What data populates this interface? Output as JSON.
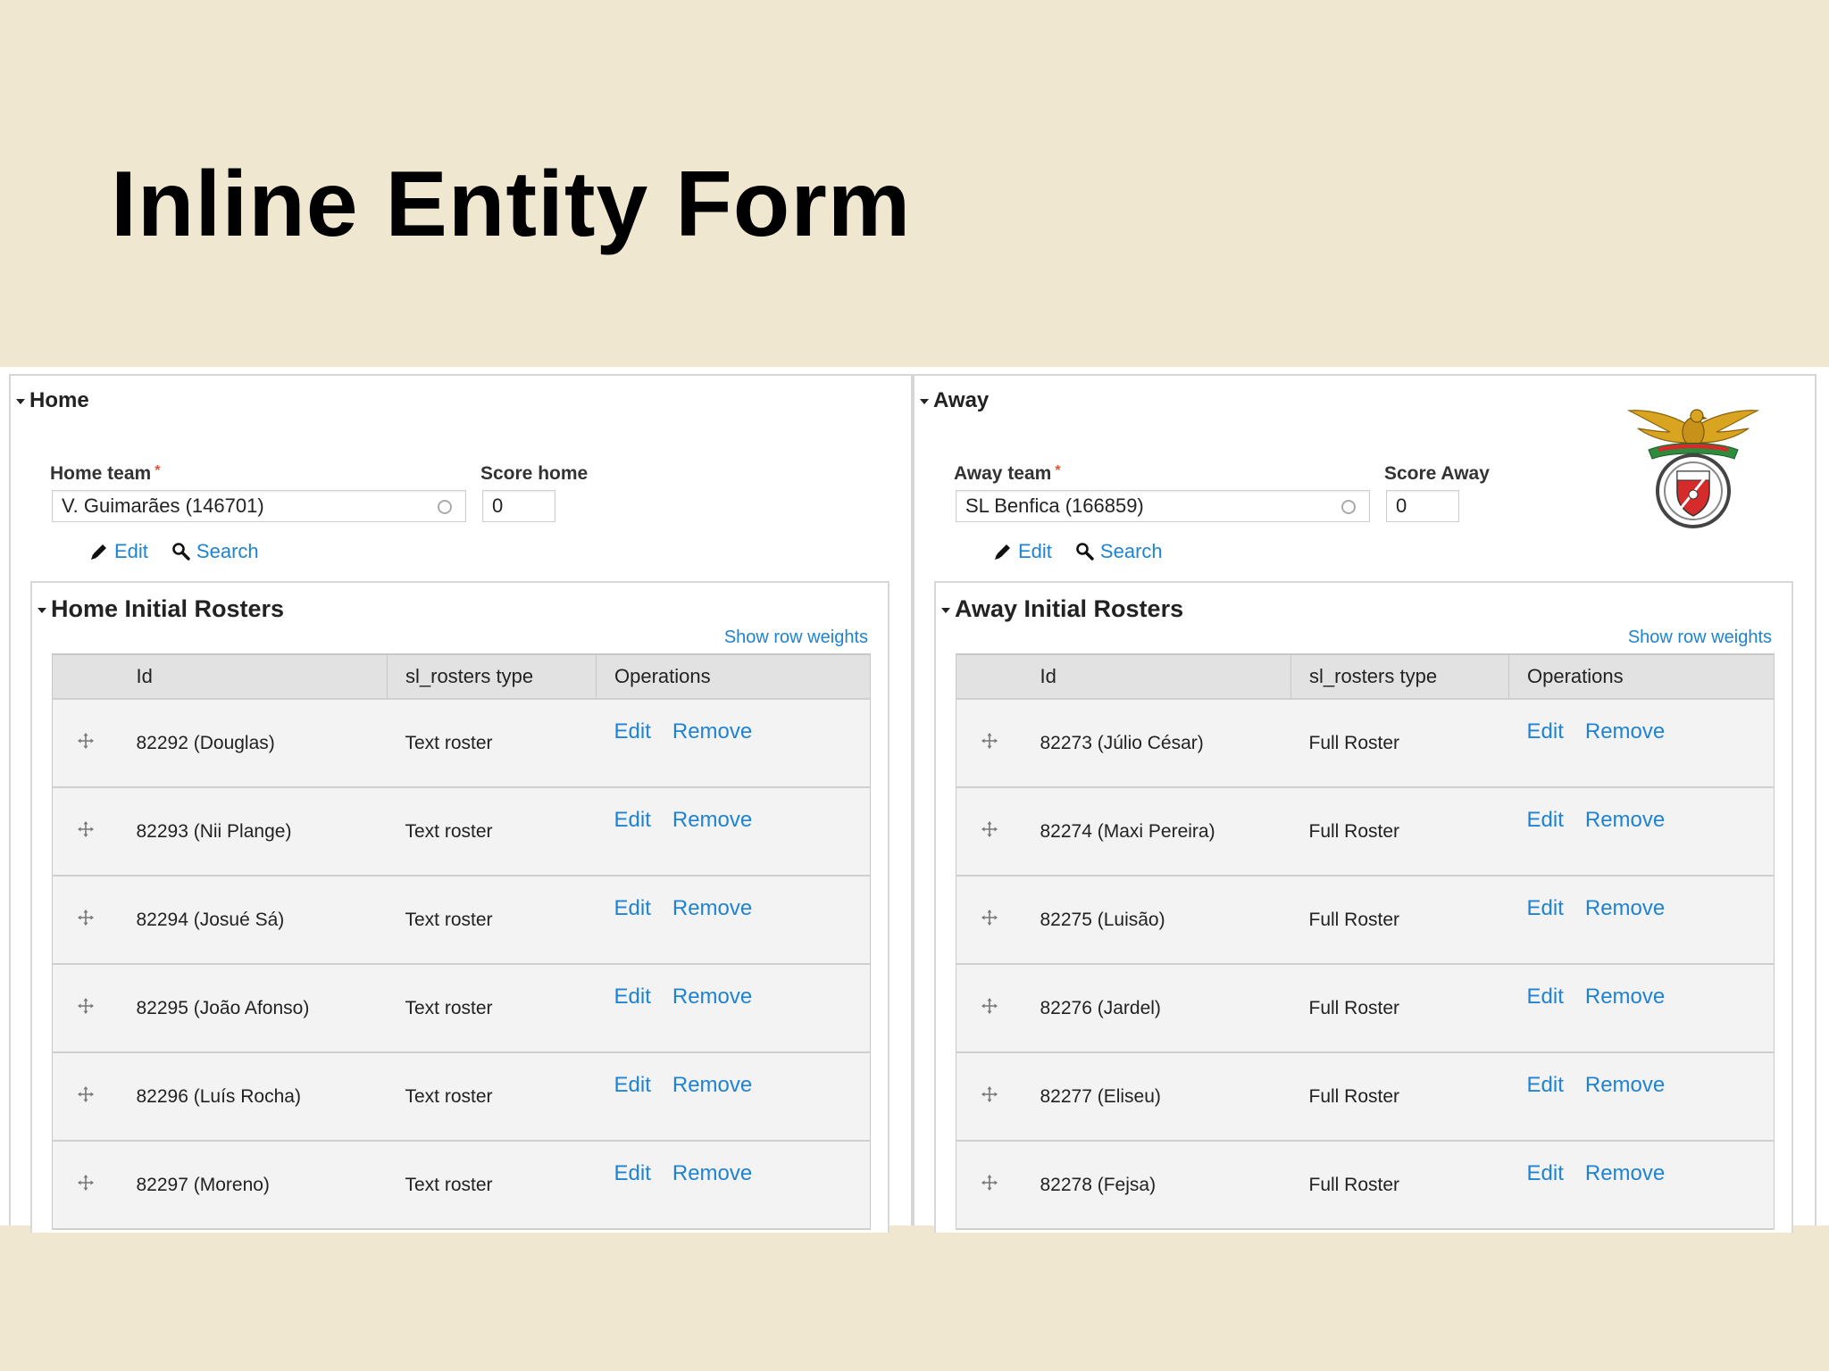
{
  "slide": {
    "title": "Inline Entity Form"
  },
  "home": {
    "legend": "Home",
    "team_label": "Home team",
    "required_mark": "*",
    "team_value": "V. Guimarães (146701)",
    "score_label": "Score home",
    "score_value": "0",
    "edit_link": "Edit",
    "search_link": "Search",
    "rosters": {
      "legend": "Home Initial Rosters",
      "show_weights": "Show row weights",
      "columns": [
        "Id",
        "sl_rosters type",
        "Operations"
      ],
      "rows": [
        {
          "id": "82292 (Douglas)",
          "type": "Text roster"
        },
        {
          "id": "82293 (Nii Plange)",
          "type": "Text roster"
        },
        {
          "id": "82294 (Josué Sá)",
          "type": "Text roster"
        },
        {
          "id": "82295 (João Afonso)",
          "type": "Text roster"
        },
        {
          "id": "82296 (Luís Rocha)",
          "type": "Text roster"
        },
        {
          "id": "82297 (Moreno)",
          "type": "Text roster"
        }
      ],
      "edit_label": "Edit",
      "remove_label": "Remove"
    }
  },
  "away": {
    "legend": "Away",
    "team_label": "Away team",
    "required_mark": "*",
    "team_value": "SL Benfica (166859)",
    "score_label": "Score Away",
    "score_value": "0",
    "edit_link": "Edit",
    "search_link": "Search",
    "rosters": {
      "legend": "Away Initial Rosters",
      "show_weights": "Show row weights",
      "columns": [
        "Id",
        "sl_rosters type",
        "Operations"
      ],
      "rows": [
        {
          "id": "82273 (Júlio César)",
          "type": "Full Roster"
        },
        {
          "id": "82274 (Maxi Pereira)",
          "type": "Full Roster"
        },
        {
          "id": "82275 (Luisão)",
          "type": "Full Roster"
        },
        {
          "id": "82276 (Jardel)",
          "type": "Full Roster"
        },
        {
          "id": "82277 (Eliseu)",
          "type": "Full Roster"
        },
        {
          "id": "82278 (Fejsa)",
          "type": "Full Roster"
        }
      ],
      "edit_label": "Edit",
      "remove_label": "Remove"
    }
  },
  "colors": {
    "background": "#f0e7d1",
    "link": "#1f83d4",
    "required": "#e2562b",
    "header_bg": "#e2e2e2",
    "row_bg": "#f3f3f3"
  },
  "icons": {
    "edit": "pencil-icon",
    "search": "magnifier-icon",
    "drag": "drag-handle-icon",
    "autocomplete": "autocomplete-throbber-icon",
    "crest": "sl-benfica-crest"
  }
}
